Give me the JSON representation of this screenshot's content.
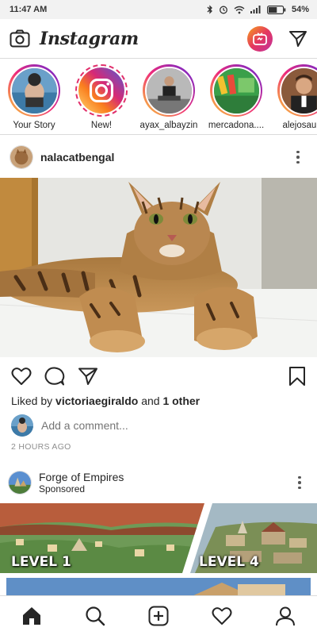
{
  "status_bar": {
    "time": "11:47 AM",
    "battery_percent": "54%",
    "icons": [
      "bluetooth-icon",
      "alarm-icon",
      "wifi-icon",
      "signal-icon",
      "battery-icon"
    ]
  },
  "header": {
    "title": "Instagram",
    "left_icon": "camera-icon",
    "igtv_icon": "igtv-icon",
    "right_icon": "direct-message-icon"
  },
  "stories": [
    {
      "label": "Your Story",
      "ring": "gradient"
    },
    {
      "label": "New!",
      "ring": "dashed"
    },
    {
      "label": "ayax_albayzin",
      "ring": "gradient"
    },
    {
      "label": "mercadona....",
      "ring": "gradient"
    },
    {
      "label": "alejosaura",
      "ring": "gradient"
    }
  ],
  "post": {
    "username": "nalacatbengal",
    "liked_by_prefix": "Liked by",
    "liked_by_user": "victoriaegiraldo",
    "liked_by_and": "and",
    "liked_by_others": "1 other",
    "comment_placeholder": "Add a comment...",
    "time_ago": "2 HOURS AGO"
  },
  "sponsored_post": {
    "name": "Forge of Empires",
    "subtitle": "Sponsored",
    "level_left": "LEVEL 1",
    "level_right": "LEVEL 4"
  },
  "bottom_nav": [
    "home-icon",
    "search-icon",
    "new-post-icon",
    "activity-heart-icon",
    "profile-icon"
  ],
  "colors": {
    "ring_gradient": [
      "#f9ce34",
      "#ee2a7b",
      "#6228d7"
    ],
    "text_primary": "#262626",
    "text_secondary": "#8e8e8e",
    "divider": "#dbdbdb"
  }
}
